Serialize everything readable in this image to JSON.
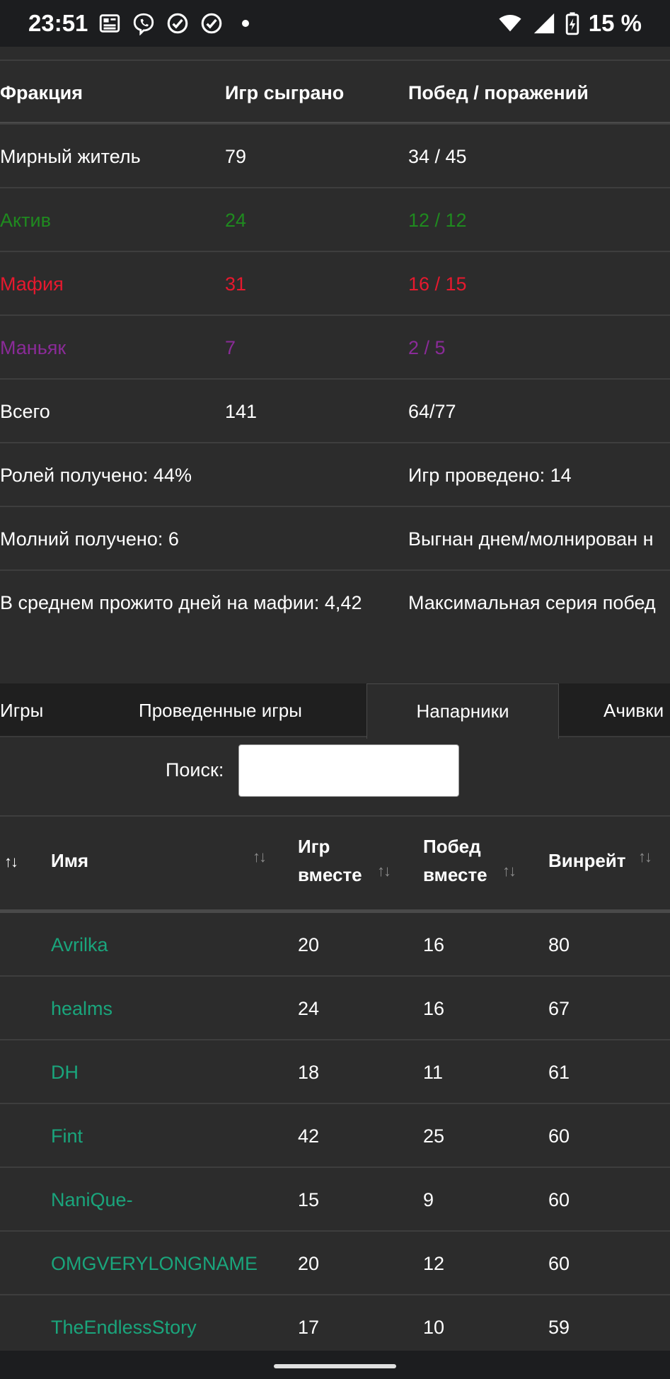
{
  "status_bar": {
    "time": "23:51",
    "battery": "15 %",
    "left_icons": [
      "news-icon",
      "viber-icon",
      "check-circle-icon",
      "check-circle-icon",
      "notification-dot-icon"
    ],
    "right_icons": [
      "wifi-icon",
      "signal-icon",
      "battery-charging-icon"
    ]
  },
  "faction_table": {
    "headers": [
      "Фракция",
      "Игр сыграно",
      "Побед / поражений"
    ],
    "rows": [
      {
        "faction": "Мирный житель",
        "games": "79",
        "wl": "34 / 45",
        "color": "#ffffff"
      },
      {
        "faction": "Актив",
        "games": "24",
        "wl": "12 / 12",
        "color": "#1f8a1f"
      },
      {
        "faction": "Мафия",
        "games": "31",
        "wl": "16 / 15",
        "color": "#e6192e"
      },
      {
        "faction": "Маньяк",
        "games": "7",
        "wl": "2 / 5",
        "color": "#8a2b98"
      },
      {
        "faction": "Всего",
        "games": "141",
        "wl": "64/77",
        "color": "#ffffff"
      }
    ],
    "stats": [
      {
        "left": "Ролей получено: 44%",
        "right": "Игр проведено: 14"
      },
      {
        "left": "Молний получено: 6",
        "right": "Выгнан днем/молнирован н"
      },
      {
        "left": "В среднем прожито дней на мафии: 4,42",
        "right": "Максимальная серия побед"
      }
    ]
  },
  "tabs": [
    {
      "label": "Игры",
      "active": false
    },
    {
      "label": "Проведенные игры",
      "active": false
    },
    {
      "label": "Напарники",
      "active": true
    },
    {
      "label": "Ачивки",
      "active": false
    }
  ],
  "search": {
    "label": "Поиск:",
    "value": ""
  },
  "partners_table": {
    "headers": {
      "name": "Имя",
      "games_line1": "Игр",
      "games_line2": "вместе",
      "wins_line1": "Побед",
      "wins_line2": "вместе",
      "winrate": "Винрейт"
    },
    "sort_glyph": "↑↓",
    "rows": [
      {
        "name": "Avrilka",
        "games": "20",
        "wins": "16",
        "winrate": "80"
      },
      {
        "name": "healms",
        "games": "24",
        "wins": "16",
        "winrate": "67"
      },
      {
        "name": "DH",
        "games": "18",
        "wins": "11",
        "winrate": "61"
      },
      {
        "name": "Fint",
        "games": "42",
        "wins": "25",
        "winrate": "60"
      },
      {
        "name": "NaniQue-",
        "games": "15",
        "wins": "9",
        "winrate": "60"
      },
      {
        "name": "OMGVERYLONGNAME",
        "games": "20",
        "wins": "12",
        "winrate": "60"
      },
      {
        "name": "TheEndlessStory",
        "games": "17",
        "wins": "10",
        "winrate": "59"
      }
    ]
  },
  "colors": {
    "name_link": "#1aa57c",
    "background": "#2c2c2c"
  }
}
